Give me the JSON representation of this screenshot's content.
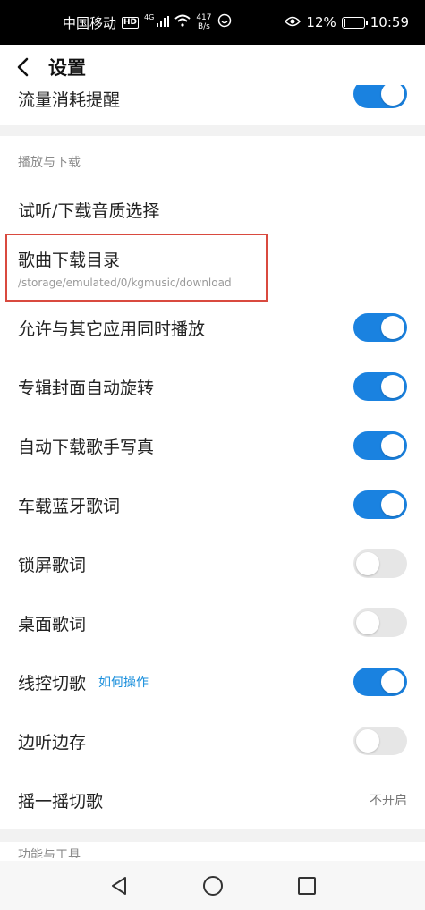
{
  "status_bar": {
    "carrier": "中国移动",
    "hd": "HD",
    "network": "4G",
    "speed_value": "417",
    "speed_unit": "B/s",
    "battery": "12%",
    "time": "10:59"
  },
  "header": {
    "title": "设置"
  },
  "partial_row": {
    "label": "流量消耗提醒",
    "toggle_on": true
  },
  "sections": {
    "playback": {
      "label": "播放与下载",
      "quality_label": "试听/下载音质选择",
      "download_dir_label": "歌曲下载目录",
      "download_dir_path": "/storage/emulated/0/kgmusic/download"
    },
    "tools_label": "功能与工具"
  },
  "toggles": [
    {
      "label": "允许与其它应用同时播放",
      "on": true
    },
    {
      "label": "专辑封面自动旋转",
      "on": true
    },
    {
      "label": "自动下载歌手写真",
      "on": true
    },
    {
      "label": "车载蓝牙歌词",
      "on": true
    },
    {
      "label": "锁屏歌词",
      "on": false
    },
    {
      "label": "桌面歌词",
      "on": false
    },
    {
      "label": "线控切歌",
      "on": true,
      "help": "如何操作"
    },
    {
      "label": "边听边存",
      "on": false
    }
  ],
  "shake": {
    "label": "摇一摇切歌",
    "value": "不开启"
  },
  "colors": {
    "accent": "#1a82e0",
    "highlight_border": "#d94a3f",
    "toggle_off": "#e6e6e6"
  },
  "icons": {
    "back": "chevron-left-icon",
    "nav_back": "triangle-back-icon",
    "nav_home": "circle-home-icon",
    "nav_recent": "square-recent-icon"
  }
}
